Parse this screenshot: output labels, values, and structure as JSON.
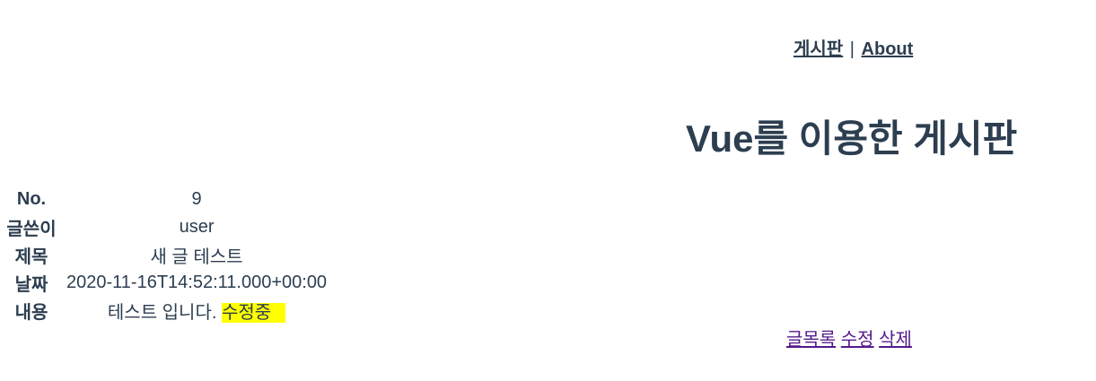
{
  "nav": {
    "board_label": "게시판",
    "separator": "|",
    "about_label": "About"
  },
  "title": "Vue를 이용한 게시판",
  "detail": {
    "rows": [
      {
        "label": "No.",
        "value": "9"
      },
      {
        "label": "글쓴이",
        "value": "user"
      },
      {
        "label": "제목",
        "value": "새 글 테스트"
      },
      {
        "label": "날짜",
        "value": "2020-11-16T14:52:11.000+00:00"
      },
      {
        "label": "내용",
        "value": "테스트 입니다. ",
        "highlight": "수정중"
      }
    ]
  },
  "actions": {
    "list_label": "글목록",
    "edit_label": "수정",
    "delete_label": "삭제"
  },
  "colors": {
    "text": "#2c3e50",
    "link_visited": "#551a8b",
    "highlight": "#ffff00"
  }
}
